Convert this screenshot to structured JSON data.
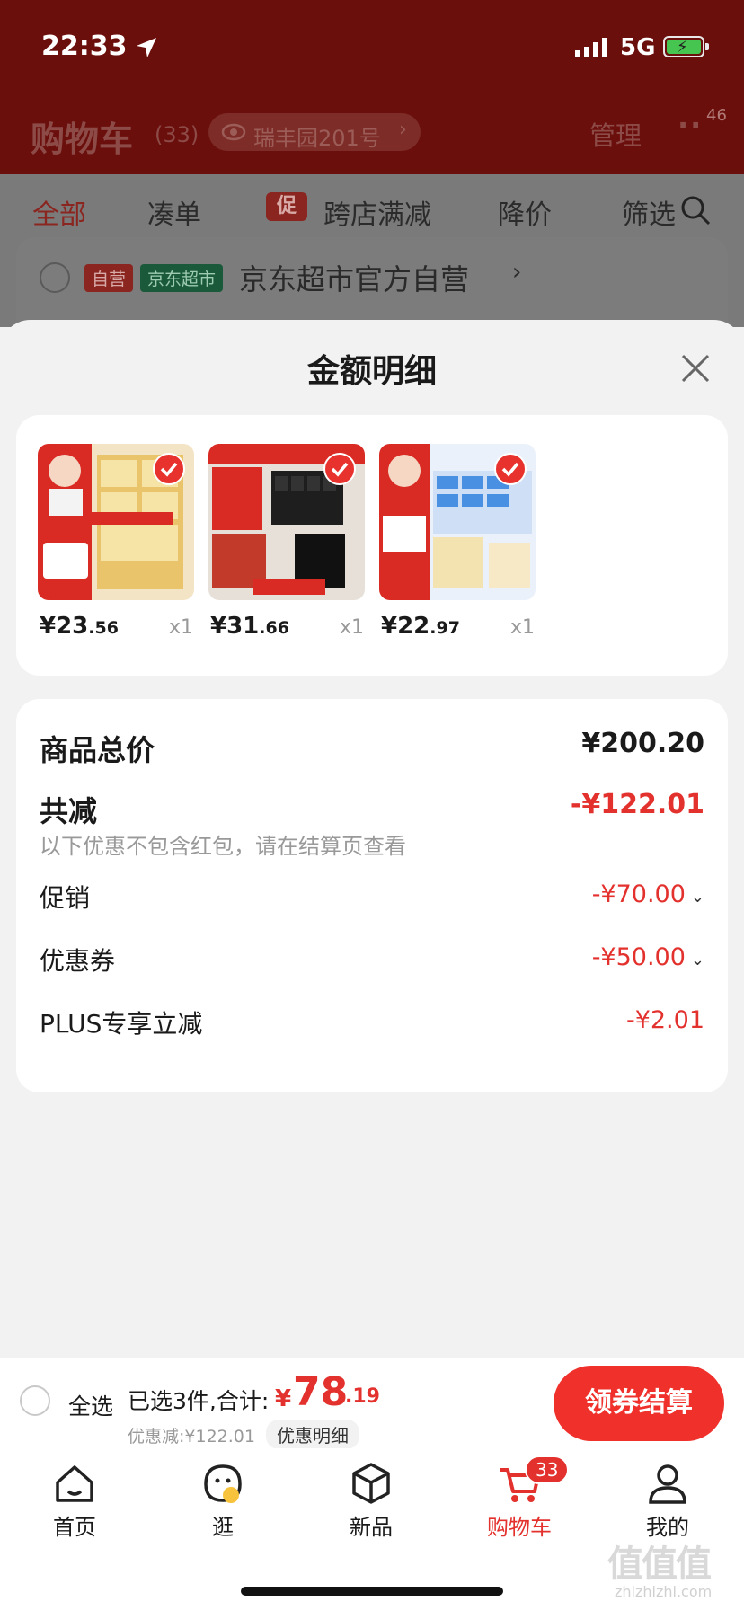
{
  "status_bar": {
    "time": "22:33",
    "network": "5G"
  },
  "header": {
    "title": "购物车",
    "count": "(33)",
    "address": "瑞丰园201号",
    "manage": "管理",
    "more_badge": "46"
  },
  "filter_tabs": [
    {
      "label": "全部",
      "active": true
    },
    {
      "label": "凑单",
      "active": false
    },
    {
      "label": "跨店满减",
      "active": false,
      "badge": "促"
    },
    {
      "label": "降价",
      "active": false
    },
    {
      "label": "筛选",
      "active": false
    }
  ],
  "store": {
    "tag_self": "自营",
    "tag_market": "京东超市",
    "name": "京东超市官方自营"
  },
  "sheet": {
    "title": "金额明细",
    "items": [
      {
        "price_int": "¥23",
        "price_dec": ".56",
        "qty": "x1"
      },
      {
        "price_int": "¥31",
        "price_dec": ".66",
        "qty": "x1"
      },
      {
        "price_int": "¥22",
        "price_dec": ".97",
        "qty": "x1"
      }
    ],
    "summary": {
      "total_label": "商品总价",
      "total_value": "¥200.20",
      "reduce_label": "共减",
      "reduce_value": "-¥122.01",
      "reduce_note": "以下优惠不包含红包，请在结算页查看",
      "lines": [
        {
          "label": "促销",
          "value": "-¥70.00",
          "expandable": true
        },
        {
          "label": "优惠券",
          "value": "-¥50.00",
          "expandable": true
        },
        {
          "label": "PLUS专享立减",
          "value": "-¥2.01",
          "expandable": false
        }
      ]
    }
  },
  "bottom_bar": {
    "select_all": "全选",
    "selected": "已选3件,合计:",
    "currency": "¥",
    "total_int": "78",
    "total_dec": ".19",
    "reduced": "优惠减:¥122.01",
    "detail": "优惠明细",
    "checkout": "领券结算"
  },
  "tab_bar": [
    {
      "label": "首页",
      "icon": "home-icon",
      "active": false
    },
    {
      "label": "逛",
      "icon": "stroll-icon",
      "active": false
    },
    {
      "label": "新品",
      "icon": "box-icon",
      "active": false
    },
    {
      "label": "购物车",
      "icon": "cart-icon",
      "active": true,
      "badge": "33"
    },
    {
      "label": "我的",
      "icon": "profile-icon",
      "active": false
    }
  ],
  "watermark": {
    "main": "值值值",
    "sub": "zhizhizhi.com"
  },
  "colors": {
    "accent": "#e3312d",
    "header_bg": "#6b0f0d"
  }
}
